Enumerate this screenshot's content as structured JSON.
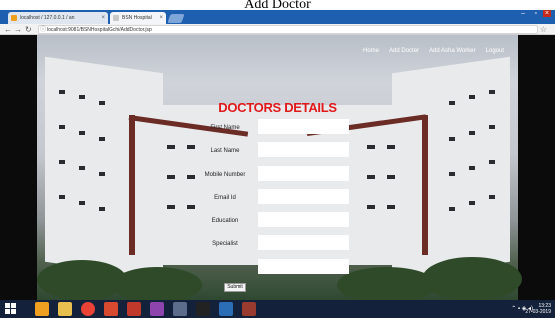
{
  "caption": "Add Doctor",
  "browser": {
    "tabs": [
      {
        "label": "localhost / 127.0.0.1 / an",
        "active": false
      },
      {
        "label": "BSN Hospital",
        "active": true
      }
    ],
    "url": "localhost:9081/BSNHospitalGchi/AddDoctor.jsp"
  },
  "topnav": {
    "items": [
      "Home",
      "Add Docter",
      "Add Asha Worker",
      "Logout"
    ]
  },
  "form": {
    "title": "DOCTORS DETAILS",
    "fields": [
      {
        "label": "First Name",
        "value": ""
      },
      {
        "label": "Last Name",
        "value": ""
      },
      {
        "label": "Mobile Number",
        "value": ""
      },
      {
        "label": "Email Id",
        "value": ""
      },
      {
        "label": "Education",
        "value": ""
      },
      {
        "label": "Specialist",
        "value": ""
      },
      {
        "label": "",
        "value": ""
      }
    ],
    "submit_label": "Submit"
  },
  "taskbar": {
    "time": "13:23",
    "date": "27-03-2019"
  },
  "colors": {
    "accent_title": "#e0191b",
    "tabbar": "#1f5fb0",
    "taskbar": "#13213a"
  }
}
